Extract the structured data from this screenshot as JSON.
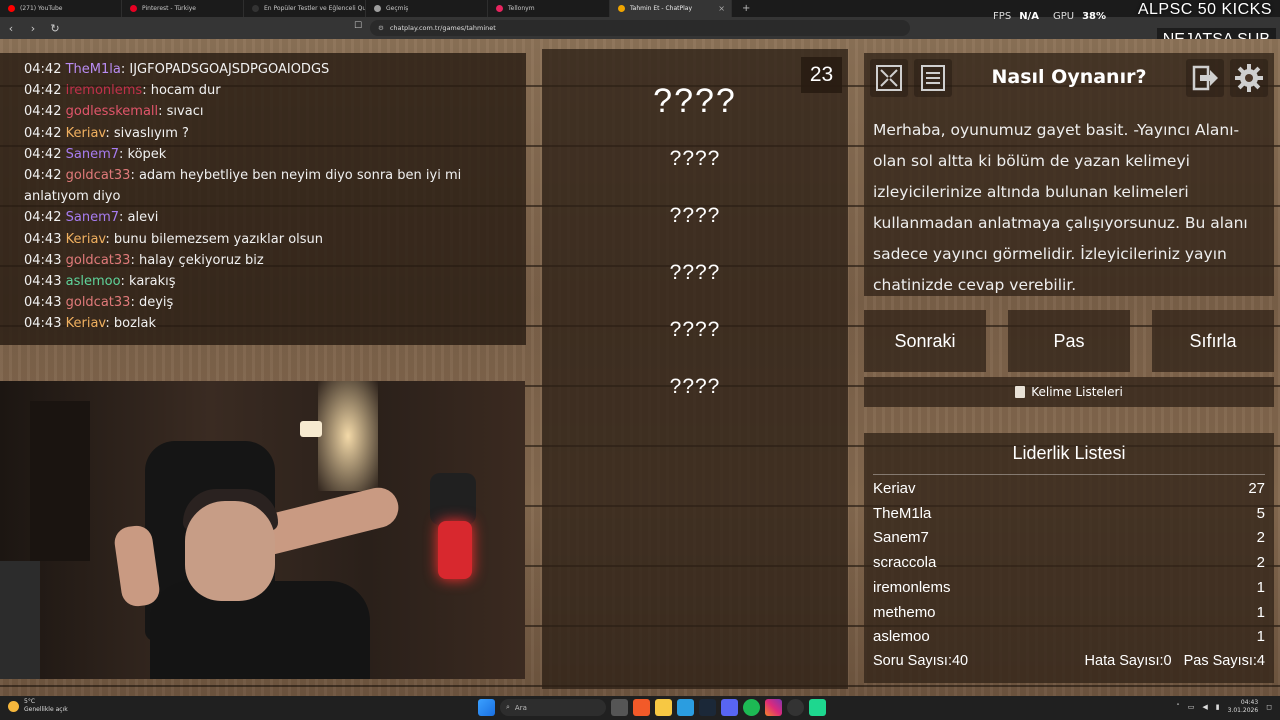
{
  "browser": {
    "tabs": [
      {
        "label": "(271) YouTube",
        "color": "#ff0000"
      },
      {
        "label": "Pinterest - Türkiye",
        "color": "#e60023"
      },
      {
        "label": "En Popüler Testler ve Eğlenceli Quizle…",
        "color": "#333333"
      },
      {
        "label": "Geçmiş",
        "color": "#9e9e9e"
      },
      {
        "label": "Tellonym",
        "color": "#e8245f"
      },
      {
        "label": "Tahmin Et - ChatPlay",
        "color": "#f0a500",
        "active": true
      }
    ],
    "url": "chatplay.com.tr/games/tahminet"
  },
  "overlay": {
    "fps_label": "FPS",
    "fps_value": "N/A",
    "gpu_label": "GPU",
    "gpu_value": "38%",
    "banner": "ALPSC 50 KICKS",
    "sub": "NEJATSA SUB"
  },
  "chat": {
    "messages": [
      {
        "time": "04:42",
        "user": "TheM1la",
        "color": "#b98cf2",
        "text": ": IJGFOPADSGOAJSDPGOAIODGS"
      },
      {
        "time": "04:42",
        "user": "iremonlems",
        "color": "#c0304a",
        "text": ": hocam dur"
      },
      {
        "time": "04:42",
        "user": "godlesskemall",
        "color": "#e0556a",
        "text": ": sıvacı"
      },
      {
        "time": "04:42",
        "user": "Keriav",
        "color": "#f0b060",
        "text": ": sivaslıyım ?"
      },
      {
        "time": "04:42",
        "user": "Sanem7",
        "color": "#a77cf0",
        "text": ": köpek"
      },
      {
        "time": "04:42",
        "user": "goldcat33",
        "color": "#e07a7a",
        "text": ": adam heybetliye ben neyim diyo sonra ben iyi mi anlatıyom diyo"
      },
      {
        "time": "04:42",
        "user": "Sanem7",
        "color": "#a77cf0",
        "text": ": alevi"
      },
      {
        "time": "04:43",
        "user": "Keriav",
        "color": "#f0b060",
        "text": ": bunu bilemezsem yazıklar olsun"
      },
      {
        "time": "04:43",
        "user": "goldcat33",
        "color": "#e07a7a",
        "text": ": halay çekiyoruz biz"
      },
      {
        "time": "04:43",
        "user": "aslemoo",
        "color": "#5fd39a",
        "text": ": karakış"
      },
      {
        "time": "04:43",
        "user": "goldcat33",
        "color": "#e07a7a",
        "text": ": deyiş"
      },
      {
        "time": "04:43",
        "user": "Keriav",
        "color": "#f0b060",
        "text": ": bozlak"
      }
    ]
  },
  "board": {
    "main_word": "????",
    "hidden_words": [
      "????",
      "????",
      "????",
      "????",
      "????"
    ],
    "timer": "23"
  },
  "help": {
    "title": "Nasıl Oynanır?",
    "text": "Merhaba, oyunumuz gayet basit. -Yayıncı Alanı- olan sol altta ki bölüm de yazan kelimeyi izleyicilerinize altında bulunan kelimeleri kullanmadan anlatmaya çalışıyorsunuz. Bu alanı sadece yayıncı görmelidir. İzleyicileriniz yayın chatinizde cevap verebilir.",
    "icons": [
      "fullscreen-icon",
      "list-icon",
      "exit-icon",
      "settings-icon"
    ]
  },
  "controls": {
    "next": "Sonraki",
    "pass": "Pas",
    "reset": "Sıfırla",
    "word_lists": "Kelime Listeleri"
  },
  "leaderboard": {
    "title": "Liderlik Listesi",
    "rows": [
      {
        "name": "Keriav",
        "score": "27"
      },
      {
        "name": "TheM1la",
        "score": "5"
      },
      {
        "name": "Sanem7",
        "score": "2"
      },
      {
        "name": "scraccola",
        "score": "2"
      },
      {
        "name": "iremonlems",
        "score": "1"
      },
      {
        "name": "methemo",
        "score": "1"
      },
      {
        "name": "aslemoo",
        "score": "1"
      }
    ],
    "questions": "Soru Sayısı:40",
    "errors": "Hata Sayısı:0",
    "passes": "Pas Sayısı:4"
  },
  "taskbar": {
    "temp": "5°C",
    "weather": "Genellikle açık",
    "search_placeholder": "Ara",
    "time": "04:43",
    "date": "3.01.2026"
  }
}
